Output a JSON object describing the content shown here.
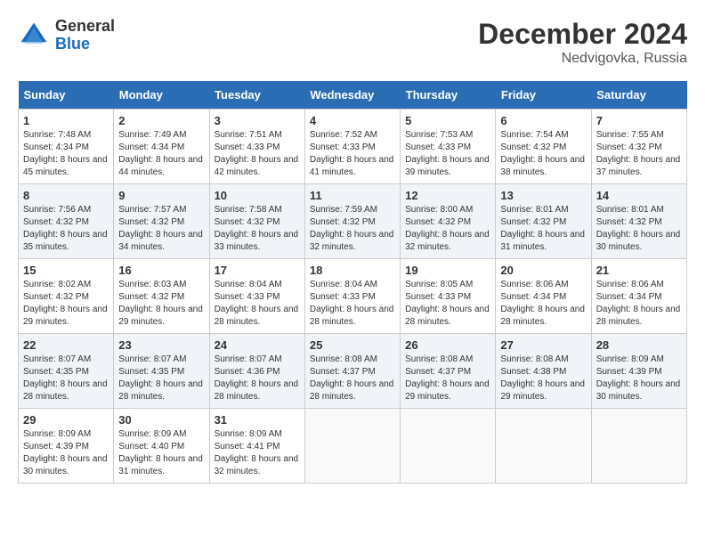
{
  "logo": {
    "general": "General",
    "blue": "Blue"
  },
  "title": "December 2024",
  "location": "Nedvigovka, Russia",
  "days_of_week": [
    "Sunday",
    "Monday",
    "Tuesday",
    "Wednesday",
    "Thursday",
    "Friday",
    "Saturday"
  ],
  "weeks": [
    [
      {
        "day": "1",
        "sunrise": "Sunrise: 7:48 AM",
        "sunset": "Sunset: 4:34 PM",
        "daylight": "Daylight: 8 hours and 45 minutes."
      },
      {
        "day": "2",
        "sunrise": "Sunrise: 7:49 AM",
        "sunset": "Sunset: 4:34 PM",
        "daylight": "Daylight: 8 hours and 44 minutes."
      },
      {
        "day": "3",
        "sunrise": "Sunrise: 7:51 AM",
        "sunset": "Sunset: 4:33 PM",
        "daylight": "Daylight: 8 hours and 42 minutes."
      },
      {
        "day": "4",
        "sunrise": "Sunrise: 7:52 AM",
        "sunset": "Sunset: 4:33 PM",
        "daylight": "Daylight: 8 hours and 41 minutes."
      },
      {
        "day": "5",
        "sunrise": "Sunrise: 7:53 AM",
        "sunset": "Sunset: 4:33 PM",
        "daylight": "Daylight: 8 hours and 39 minutes."
      },
      {
        "day": "6",
        "sunrise": "Sunrise: 7:54 AM",
        "sunset": "Sunset: 4:32 PM",
        "daylight": "Daylight: 8 hours and 38 minutes."
      },
      {
        "day": "7",
        "sunrise": "Sunrise: 7:55 AM",
        "sunset": "Sunset: 4:32 PM",
        "daylight": "Daylight: 8 hours and 37 minutes."
      }
    ],
    [
      {
        "day": "8",
        "sunrise": "Sunrise: 7:56 AM",
        "sunset": "Sunset: 4:32 PM",
        "daylight": "Daylight: 8 hours and 35 minutes."
      },
      {
        "day": "9",
        "sunrise": "Sunrise: 7:57 AM",
        "sunset": "Sunset: 4:32 PM",
        "daylight": "Daylight: 8 hours and 34 minutes."
      },
      {
        "day": "10",
        "sunrise": "Sunrise: 7:58 AM",
        "sunset": "Sunset: 4:32 PM",
        "daylight": "Daylight: 8 hours and 33 minutes."
      },
      {
        "day": "11",
        "sunrise": "Sunrise: 7:59 AM",
        "sunset": "Sunset: 4:32 PM",
        "daylight": "Daylight: 8 hours and 32 minutes."
      },
      {
        "day": "12",
        "sunrise": "Sunrise: 8:00 AM",
        "sunset": "Sunset: 4:32 PM",
        "daylight": "Daylight: 8 hours and 32 minutes."
      },
      {
        "day": "13",
        "sunrise": "Sunrise: 8:01 AM",
        "sunset": "Sunset: 4:32 PM",
        "daylight": "Daylight: 8 hours and 31 minutes."
      },
      {
        "day": "14",
        "sunrise": "Sunrise: 8:01 AM",
        "sunset": "Sunset: 4:32 PM",
        "daylight": "Daylight: 8 hours and 30 minutes."
      }
    ],
    [
      {
        "day": "15",
        "sunrise": "Sunrise: 8:02 AM",
        "sunset": "Sunset: 4:32 PM",
        "daylight": "Daylight: 8 hours and 29 minutes."
      },
      {
        "day": "16",
        "sunrise": "Sunrise: 8:03 AM",
        "sunset": "Sunset: 4:32 PM",
        "daylight": "Daylight: 8 hours and 29 minutes."
      },
      {
        "day": "17",
        "sunrise": "Sunrise: 8:04 AM",
        "sunset": "Sunset: 4:33 PM",
        "daylight": "Daylight: 8 hours and 28 minutes."
      },
      {
        "day": "18",
        "sunrise": "Sunrise: 8:04 AM",
        "sunset": "Sunset: 4:33 PM",
        "daylight": "Daylight: 8 hours and 28 minutes."
      },
      {
        "day": "19",
        "sunrise": "Sunrise: 8:05 AM",
        "sunset": "Sunset: 4:33 PM",
        "daylight": "Daylight: 8 hours and 28 minutes."
      },
      {
        "day": "20",
        "sunrise": "Sunrise: 8:06 AM",
        "sunset": "Sunset: 4:34 PM",
        "daylight": "Daylight: 8 hours and 28 minutes."
      },
      {
        "day": "21",
        "sunrise": "Sunrise: 8:06 AM",
        "sunset": "Sunset: 4:34 PM",
        "daylight": "Daylight: 8 hours and 28 minutes."
      }
    ],
    [
      {
        "day": "22",
        "sunrise": "Sunrise: 8:07 AM",
        "sunset": "Sunset: 4:35 PM",
        "daylight": "Daylight: 8 hours and 28 minutes."
      },
      {
        "day": "23",
        "sunrise": "Sunrise: 8:07 AM",
        "sunset": "Sunset: 4:35 PM",
        "daylight": "Daylight: 8 hours and 28 minutes."
      },
      {
        "day": "24",
        "sunrise": "Sunrise: 8:07 AM",
        "sunset": "Sunset: 4:36 PM",
        "daylight": "Daylight: 8 hours and 28 minutes."
      },
      {
        "day": "25",
        "sunrise": "Sunrise: 8:08 AM",
        "sunset": "Sunset: 4:37 PM",
        "daylight": "Daylight: 8 hours and 28 minutes."
      },
      {
        "day": "26",
        "sunrise": "Sunrise: 8:08 AM",
        "sunset": "Sunset: 4:37 PM",
        "daylight": "Daylight: 8 hours and 29 minutes."
      },
      {
        "day": "27",
        "sunrise": "Sunrise: 8:08 AM",
        "sunset": "Sunset: 4:38 PM",
        "daylight": "Daylight: 8 hours and 29 minutes."
      },
      {
        "day": "28",
        "sunrise": "Sunrise: 8:09 AM",
        "sunset": "Sunset: 4:39 PM",
        "daylight": "Daylight: 8 hours and 30 minutes."
      }
    ],
    [
      {
        "day": "29",
        "sunrise": "Sunrise: 8:09 AM",
        "sunset": "Sunset: 4:39 PM",
        "daylight": "Daylight: 8 hours and 30 minutes."
      },
      {
        "day": "30",
        "sunrise": "Sunrise: 8:09 AM",
        "sunset": "Sunset: 4:40 PM",
        "daylight": "Daylight: 8 hours and 31 minutes."
      },
      {
        "day": "31",
        "sunrise": "Sunrise: 8:09 AM",
        "sunset": "Sunset: 4:41 PM",
        "daylight": "Daylight: 8 hours and 32 minutes."
      },
      null,
      null,
      null,
      null
    ]
  ]
}
